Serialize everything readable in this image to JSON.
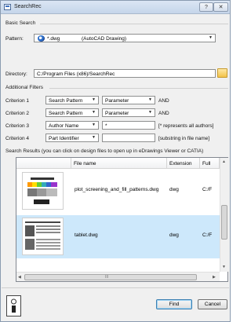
{
  "window": {
    "title": "SearchRec",
    "help_button": "?",
    "close_button": "✕"
  },
  "basic_search": {
    "section_label": "Basic Search",
    "pattern_label": "Pattern:",
    "pattern_value": "*.dwg",
    "pattern_description": "(AutoCAD Drawing)",
    "directory_label": "Directory:",
    "directory_value": "C:/Program Files (x86)/SearchRec"
  },
  "additional_filters": {
    "section_label": "Additional Filters",
    "criteria": [
      {
        "label": "Criterion 1",
        "type": "Search Pattern",
        "field_kind": "combo",
        "value": "Parameter",
        "suffix": "AND"
      },
      {
        "label": "Criterion 2",
        "type": "Search Pattern",
        "field_kind": "combo",
        "value": "Parameter",
        "suffix": "AND"
      },
      {
        "label": "Criterion 3",
        "type": "Author Name",
        "field_kind": "text",
        "value": "*",
        "suffix": "[* represents all authors]"
      },
      {
        "label": "Criterion 4",
        "type": "Part Identifier",
        "field_kind": "text",
        "value": "",
        "suffix": "[substring in file name]"
      }
    ]
  },
  "results": {
    "section_label": "Search Results (you can click on design files to open up in eDrawings Viewer or CATIA)",
    "columns": [
      "File name",
      "Extension",
      "Full"
    ],
    "rows": [
      {
        "file_name": "plot_screening_and_fill_patterns.dwg",
        "extension": "dwg",
        "full": "C:/F",
        "selected": false
      },
      {
        "file_name": "tablet.dwg",
        "extension": "dwg",
        "full": "C:/F",
        "selected": true
      }
    ],
    "hscroll_center": "III"
  },
  "footer": {
    "find_label": "Find",
    "cancel_label": "Cancel"
  },
  "colors": {
    "selection": "#cde8fb",
    "title_gradient_top": "#dbe6f4",
    "window_bg": "#f0f0f0"
  },
  "icons": {
    "pattern": "autocad-dwg-icon",
    "folder": "folder-browse-icon",
    "user": "user-card-icon"
  }
}
